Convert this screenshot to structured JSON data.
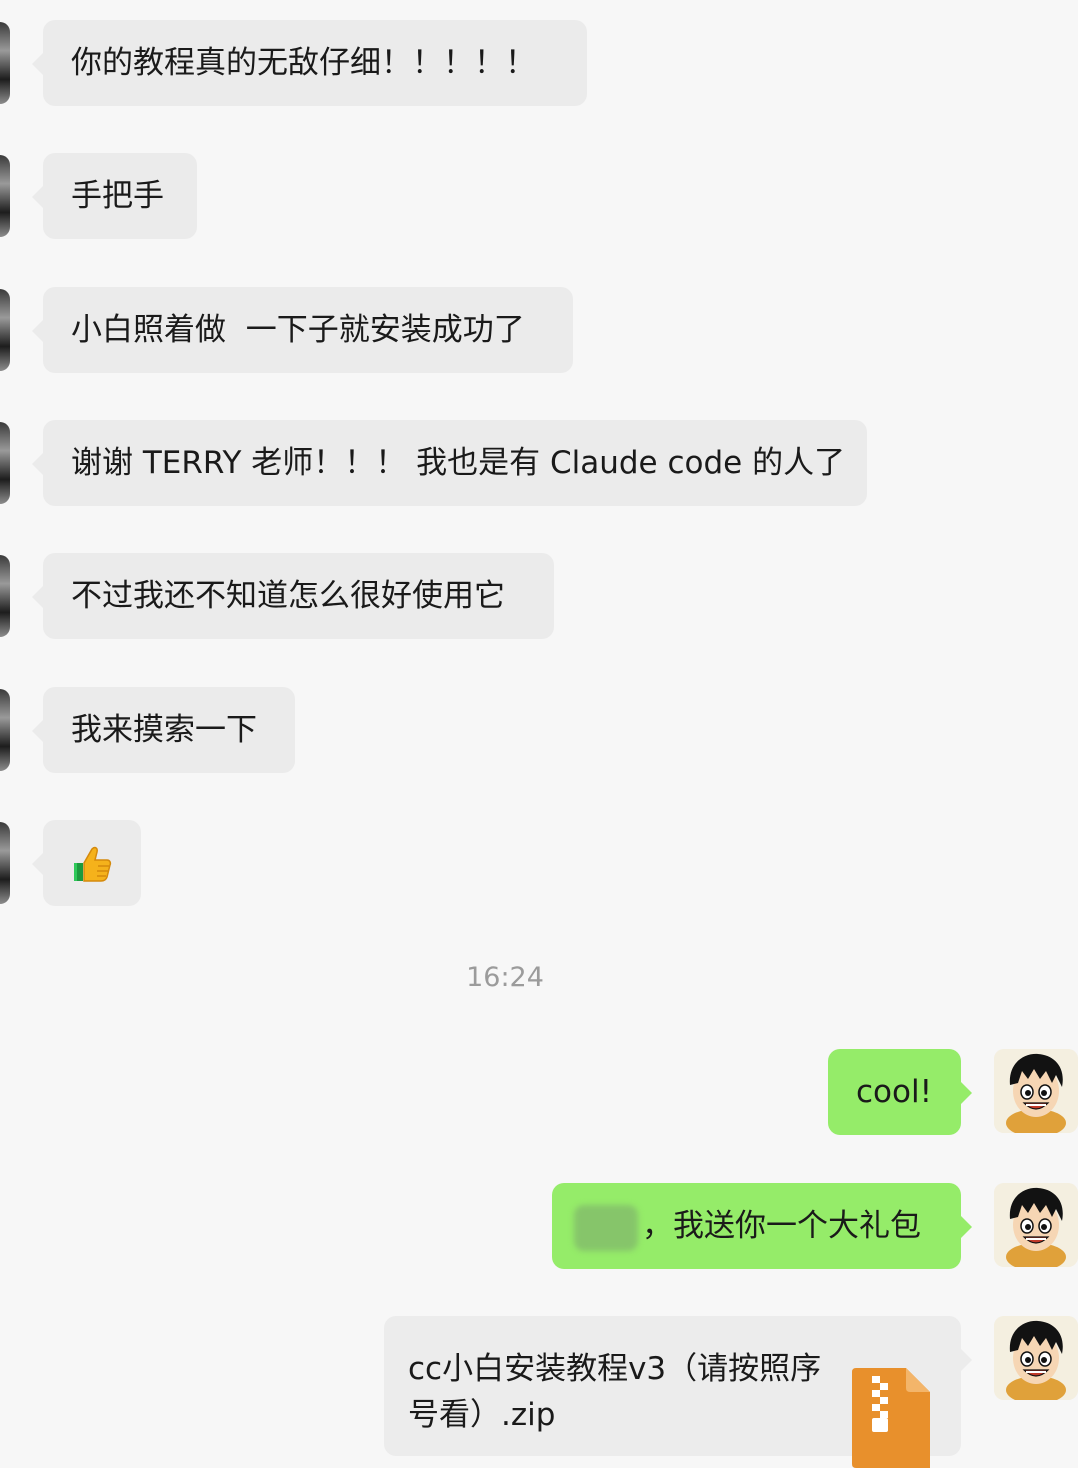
{
  "incoming_messages": [
    {
      "text": "你的教程真的无敌仔细！！！！！"
    },
    {
      "text": "手把手"
    },
    {
      "text": "小白照着做  一下子就安装成功了"
    },
    {
      "text": "谢谢 TERRY 老师！！！ 我也是有 Claude code 的人了"
    },
    {
      "text": "不过我还不知道怎么很好使用它"
    },
    {
      "text": "我来摸索一下"
    },
    {
      "text": "",
      "icon": "thumbs-up-icon"
    }
  ],
  "timestamp": "16:24",
  "outgoing_messages": [
    {
      "text": "cool!"
    },
    {
      "text": "，我送你一个大礼包"
    }
  ],
  "file_message": {
    "file_name": "cc小白安装教程v3（请按照序号看）.zip",
    "icon": "zip-file-icon",
    "icon_color": "#e8902c"
  },
  "colors": {
    "incoming_bubble": "#ebebeb",
    "outgoing_bubble": "#95ec69",
    "background": "#f7f7f7"
  }
}
